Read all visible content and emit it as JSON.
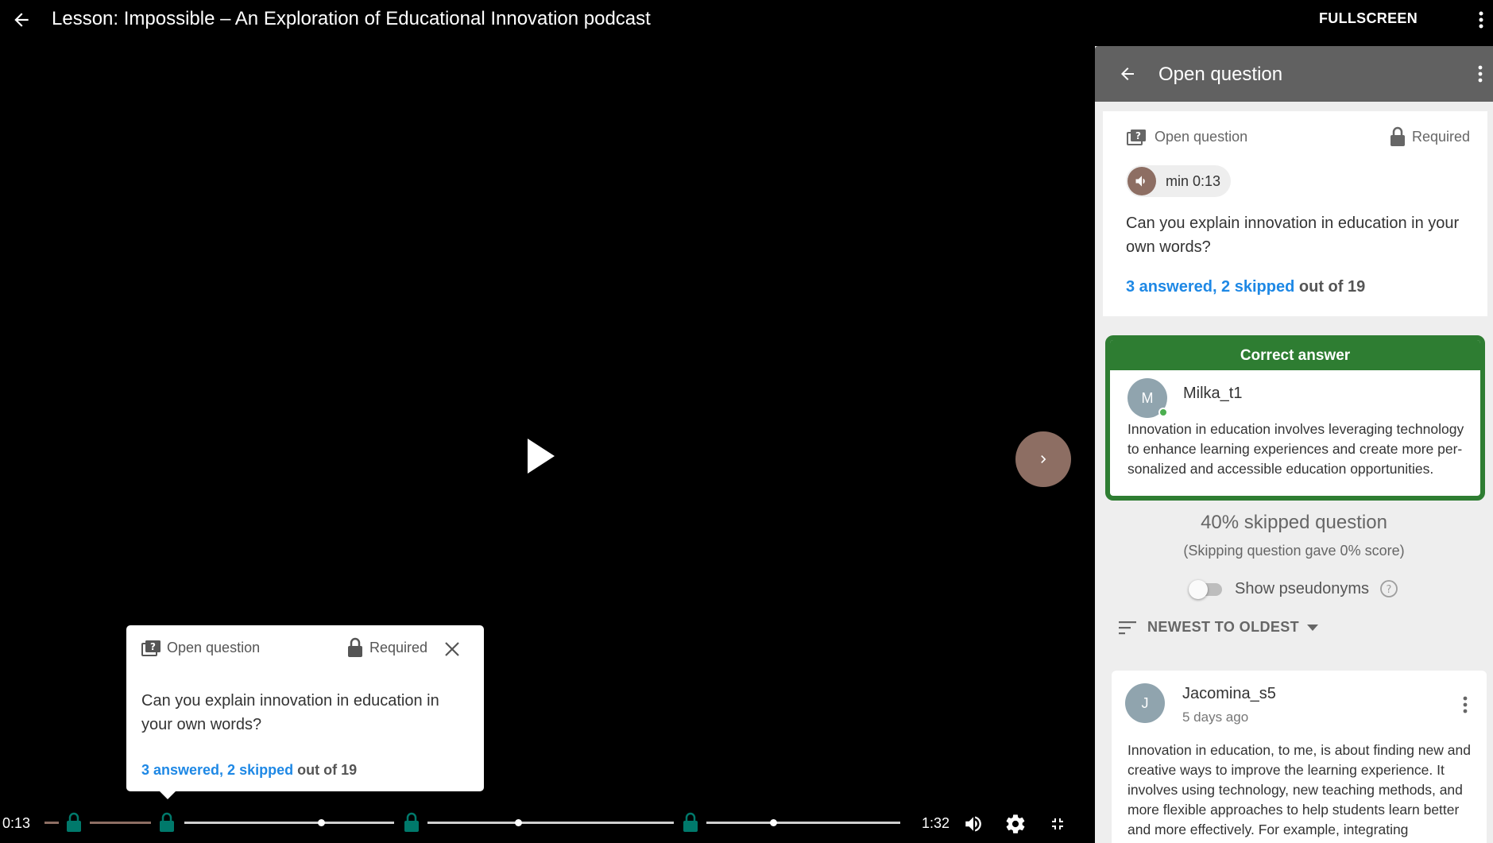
{
  "header": {
    "title": "Lesson: Impossible – An Exploration of Educational Innovation podcast",
    "fullscreen_label": "FULLSCREEN"
  },
  "popup": {
    "type_label": "Open question",
    "required_label": "Required",
    "question": "Can you explain innovation in education in your own words?",
    "stats_answered": "3 answered, 2 skipped",
    "stats_total": " out of 19"
  },
  "player": {
    "current_time": "0:13",
    "end_time": "1:32",
    "state": "paused"
  },
  "panel": {
    "title": "Open question",
    "question_card": {
      "type_label": "Open question",
      "required_label": "Required",
      "chip_label": "min 0:13",
      "question": "Can you explain innovation in education in your own words?",
      "stats_answered": "3 answered, 2 skipped",
      "stats_total": " out of 19"
    },
    "correct_answer": {
      "heading": "Correct answer",
      "avatar_initial": "M",
      "name": "Milka_t1",
      "text": "Innovation in education involves leveraging technology to enhance learning experiences and create more per-sonalized and accessible education opportunities."
    },
    "skip": {
      "title": "40% skipped question",
      "subtitle": "(Skipping question gave 0% score)"
    },
    "pseudonyms_label": "Show pseudonyms",
    "sort_label": "NEWEST TO OLDEST",
    "answers": [
      {
        "avatar_initial": "J",
        "name": "Jacomina_s5",
        "time": "5 days ago",
        "text": "Innovation in education, to me, is about finding new and creative ways to improve the learning experience. It involves using technology, new teaching methods, and more flexible approaches to help students learn better and more effectively. For example, integrating"
      }
    ]
  },
  "colors": {
    "accent_brown": "#8d6e63",
    "marker_green": "#00796b",
    "correct_green": "#2e7d32",
    "link_blue": "#1e88e5",
    "panel_header": "#616161"
  }
}
